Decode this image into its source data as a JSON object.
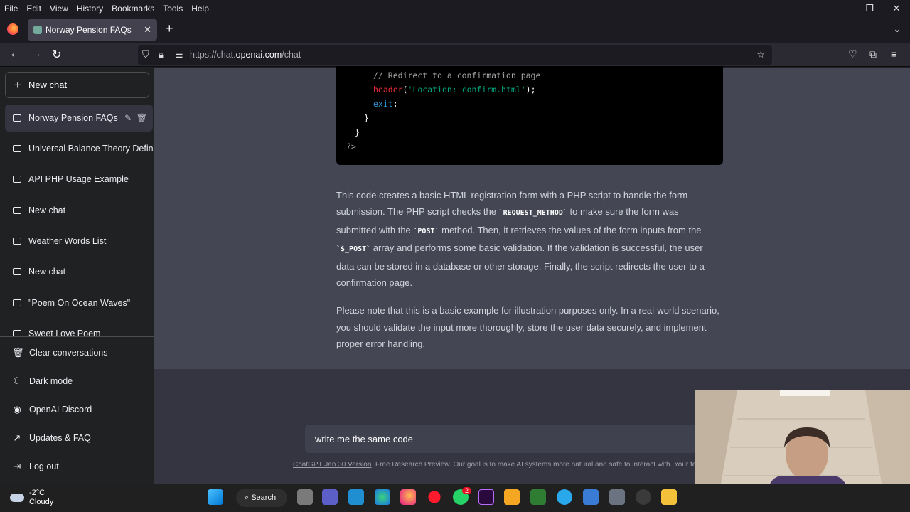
{
  "menu": [
    "File",
    "Edit",
    "View",
    "History",
    "Bookmarks",
    "Tools",
    "Help"
  ],
  "window_controls": {
    "minimize": "—",
    "maximize": "❐",
    "close": "✕"
  },
  "tab": {
    "title": "Norway Pension FAQs",
    "close": "✕"
  },
  "newtab_label": "+",
  "url": {
    "prefix": "https://chat.",
    "host": "openai.com",
    "path": "/chat"
  },
  "sidebar": {
    "new_chat": "New chat",
    "chats": [
      {
        "label": "Norway Pension FAQs",
        "active": true
      },
      {
        "label": "Universal Balance Theory Defined",
        "active": false
      },
      {
        "label": "API PHP Usage Example",
        "active": false
      },
      {
        "label": "New chat",
        "active": false
      },
      {
        "label": "Weather Words List",
        "active": false
      },
      {
        "label": "New chat",
        "active": false
      },
      {
        "label": "\"Poem On Ocean Waves\"",
        "active": false
      },
      {
        "label": "Sweet Love Poem",
        "active": false
      }
    ],
    "bottom": [
      {
        "label": "Clear conversations",
        "icon": "trash-icon"
      },
      {
        "label": "Dark mode",
        "icon": "moon-icon"
      },
      {
        "label": "OpenAI Discord",
        "icon": "discord-icon"
      },
      {
        "label": "Updates & FAQ",
        "icon": "external-link-icon"
      },
      {
        "label": "Log out",
        "icon": "logout-icon"
      }
    ]
  },
  "code": {
    "comment": "// Redirect to a confirmation page",
    "fn": "header",
    "str": "'Location: confirm.html'",
    "exit": "exit",
    "close1": "}",
    "close2": "}",
    "php_end": "?>"
  },
  "prose": {
    "p1_a": "This code creates a basic HTML registration form with a PHP script to handle the form submission. The PHP script checks the ",
    "c1": "`REQUEST_METHOD`",
    "p1_b": " to make sure the form was submitted with the ",
    "c2": "`POST`",
    "p1_c": " method. Then, it retrieves the values of the form inputs from the ",
    "c3": "`$_POST`",
    "p1_d": " array and performs some basic validation. If the validation is successful, the user data can be stored in a database or other storage. Finally, the script redirects the user to a confirmation page.",
    "p2": "Please note that this is a basic example for illustration purposes only. In a real-world scenario, you should validate the input more thoroughly, store the user data securely, and implement proper error handling."
  },
  "input": {
    "value": "write me the same code"
  },
  "footer": {
    "link": "ChatGPT Jan 30 Version",
    "text": ". Free Research Preview. Our goal is to make AI systems more natural and safe to interact with. Your feedback will help us improve."
  },
  "taskbar": {
    "weather_temp": "-2°C",
    "weather_desc": "Cloudy",
    "search_label": "Search",
    "badge": "2"
  }
}
